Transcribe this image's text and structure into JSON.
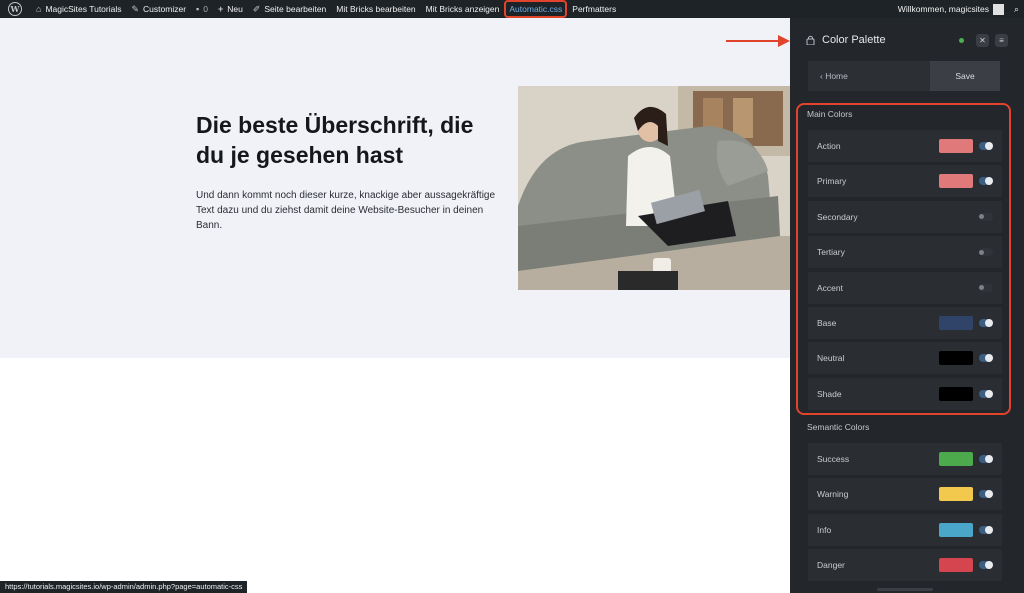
{
  "adminbar": {
    "site_name": "MagicSites Tutorials",
    "customizer": "Customizer",
    "comments_count": "0",
    "new": "Neu",
    "edit_page": "Seite bearbeiten",
    "edit_bricks": "Mit Bricks bearbeiten",
    "view_bricks": "Mit Bricks anzeigen",
    "automatic_css": "Automatic.css",
    "perfmatters": "Perfmatters",
    "welcome": "Willkommen, magicsites"
  },
  "hero": {
    "title": "Die beste Überschrift, die du je gesehen hast",
    "text": "Und dann kommt noch dieser kurze, knackige aber aussagekräftige Text dazu und du ziehst damit deine Website-Besucher in deinen Bann."
  },
  "statusbar": {
    "url": "https://tutorials.magicsites.io/wp-admin/admin.php?page=automatic-css"
  },
  "panel": {
    "title": "Color Palette",
    "home_label": "‹ Home",
    "save_label": "Save",
    "main_colors_title": "Main Colors",
    "semantic_colors_title": "Semantic Colors",
    "main_colors": [
      {
        "label": "Action",
        "color": "#e07a7a",
        "enabled": true
      },
      {
        "label": "Primary",
        "color": "#e07a7a",
        "enabled": true
      },
      {
        "label": "Secondary",
        "color": "",
        "enabled": false
      },
      {
        "label": "Tertiary",
        "color": "",
        "enabled": false
      },
      {
        "label": "Accent",
        "color": "",
        "enabled": false
      },
      {
        "label": "Base",
        "color": "#2f4468",
        "enabled": true
      },
      {
        "label": "Neutral",
        "color": "#000000",
        "enabled": true
      },
      {
        "label": "Shade",
        "color": "#000000",
        "enabled": true
      }
    ],
    "semantic_colors": [
      {
        "label": "Success",
        "color": "#4caa4c",
        "enabled": true
      },
      {
        "label": "Warning",
        "color": "#f2c94c",
        "enabled": true
      },
      {
        "label": "Info",
        "color": "#4aa7c9",
        "enabled": true
      },
      {
        "label": "Danger",
        "color": "#d54550",
        "enabled": true
      }
    ]
  },
  "colors": {
    "accent_highlight": "#e2432c",
    "panel_bg": "#23262a",
    "admin_bg": "#1d2327"
  }
}
